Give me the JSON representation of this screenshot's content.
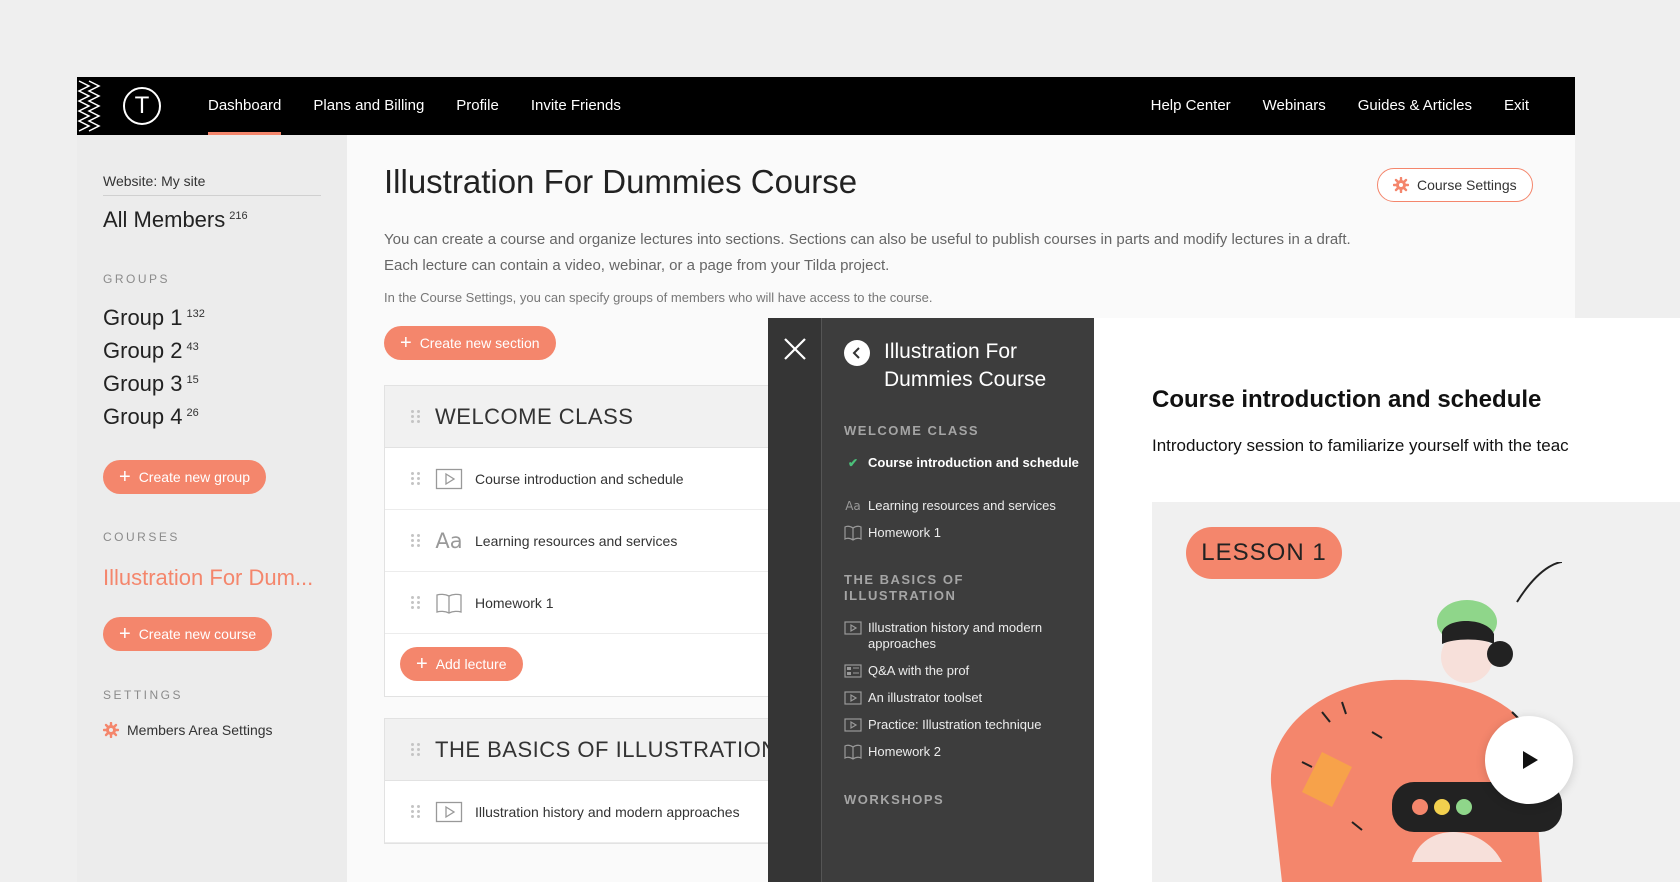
{
  "topbar": {
    "nav_left": [
      "Dashboard",
      "Plans and Billing",
      "Profile",
      "Invite Friends"
    ],
    "nav_right": [
      "Help Center",
      "Webinars",
      "Guides & Articles",
      "Exit"
    ],
    "active": "Dashboard"
  },
  "sidebar": {
    "website_label": "Website: My site",
    "all_members": "All Members",
    "all_members_count": "216",
    "groups_heading": "GROUPS",
    "groups": [
      {
        "label": "Group 1",
        "count": "132"
      },
      {
        "label": "Group 2",
        "count": "43"
      },
      {
        "label": "Group 3",
        "count": "15"
      },
      {
        "label": "Group 4",
        "count": "26"
      }
    ],
    "create_group": "Create new group",
    "courses_heading": "COURSES",
    "course_item": "Illustration For Dum...",
    "create_course": "Create new course",
    "settings_heading": "SETTINGS",
    "settings_item": "Members Area Settings"
  },
  "main": {
    "title": "Illustration For Dummies Course",
    "settings_button": "Course Settings",
    "description": "You can create a course and organize lectures into sections. Sections can also be useful to publish courses in parts and modify lectures in a draft. Each lecture can contain a video, webinar, or a page from your Tilda project.",
    "description2": "In the Course Settings, you can specify groups of members who will have access to the course.",
    "create_section": "Create new section",
    "sections": [
      {
        "title": "WELCOME CLASS",
        "lectures": [
          {
            "title": "Course introduction and schedule",
            "icon": "play-icon"
          },
          {
            "title": "Learning resources and services",
            "icon": "text-icon"
          },
          {
            "title": "Homework 1",
            "icon": "book-icon"
          }
        ],
        "add_lecture": "Add lecture"
      },
      {
        "title": "THE BASICS OF ILLUSTRATION",
        "lectures": [
          {
            "title": "Illustration history and modern approaches",
            "icon": "play-icon"
          }
        ]
      }
    ]
  },
  "preview": {
    "course_title": "Illustration For Dummies Course",
    "menu": [
      {
        "section": "WELCOME CLASS",
        "items": [
          {
            "title": "Course introduction and schedule",
            "icon": "check-icon",
            "active": true
          },
          {
            "title": "Learning resources and services",
            "icon": "text-icon"
          },
          {
            "title": "Homework 1",
            "icon": "book-icon"
          }
        ]
      },
      {
        "section": "THE BASICS OF ILLUSTRATION",
        "items": [
          {
            "title": "Illustration history and modern approaches",
            "icon": "play-icon"
          },
          {
            "title": "Q&A with the prof",
            "icon": "grid-icon"
          },
          {
            "title": "An illustrator toolset",
            "icon": "play-icon"
          },
          {
            "title": "Practice: Illustration technique",
            "icon": "play-icon"
          },
          {
            "title": "Homework 2",
            "icon": "book-icon"
          }
        ]
      },
      {
        "section": "WORKSHOPS",
        "items": []
      }
    ],
    "content_title": "Course introduction and schedule",
    "content_text": "Introductory session to familiarize yourself with the teac",
    "lesson_badge": "LESSON 1"
  },
  "colors": {
    "accent": "#f4866c",
    "topbar": "#000000",
    "menu_bg": "#3d3d3d",
    "check": "#4bc07a"
  }
}
